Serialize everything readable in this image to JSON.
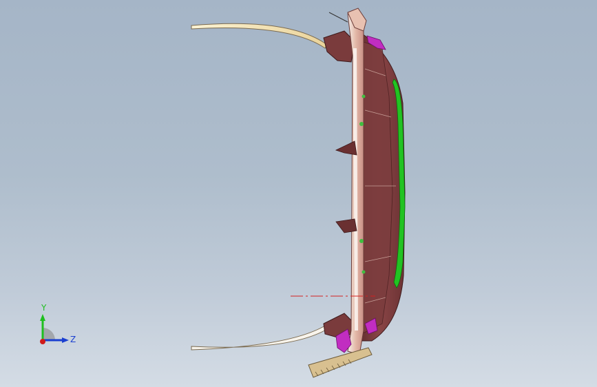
{
  "viewport": {
    "background_top": "#a5b5c7",
    "background_bottom": "#d4dce5"
  },
  "triad": {
    "y_label": "Y",
    "z_label": "Z",
    "y_color": "#1fbf1f",
    "z_color": "#1a3fd0",
    "x_color": "#d01a1a"
  },
  "model": {
    "body_color": "#7a3b3c",
    "trim_color": "#e8c8b8",
    "wire_color": "#f3e0a8",
    "accent_green": "#22c322",
    "accent_magenta": "#c12dc1",
    "reference_line_color": "#d42020"
  }
}
